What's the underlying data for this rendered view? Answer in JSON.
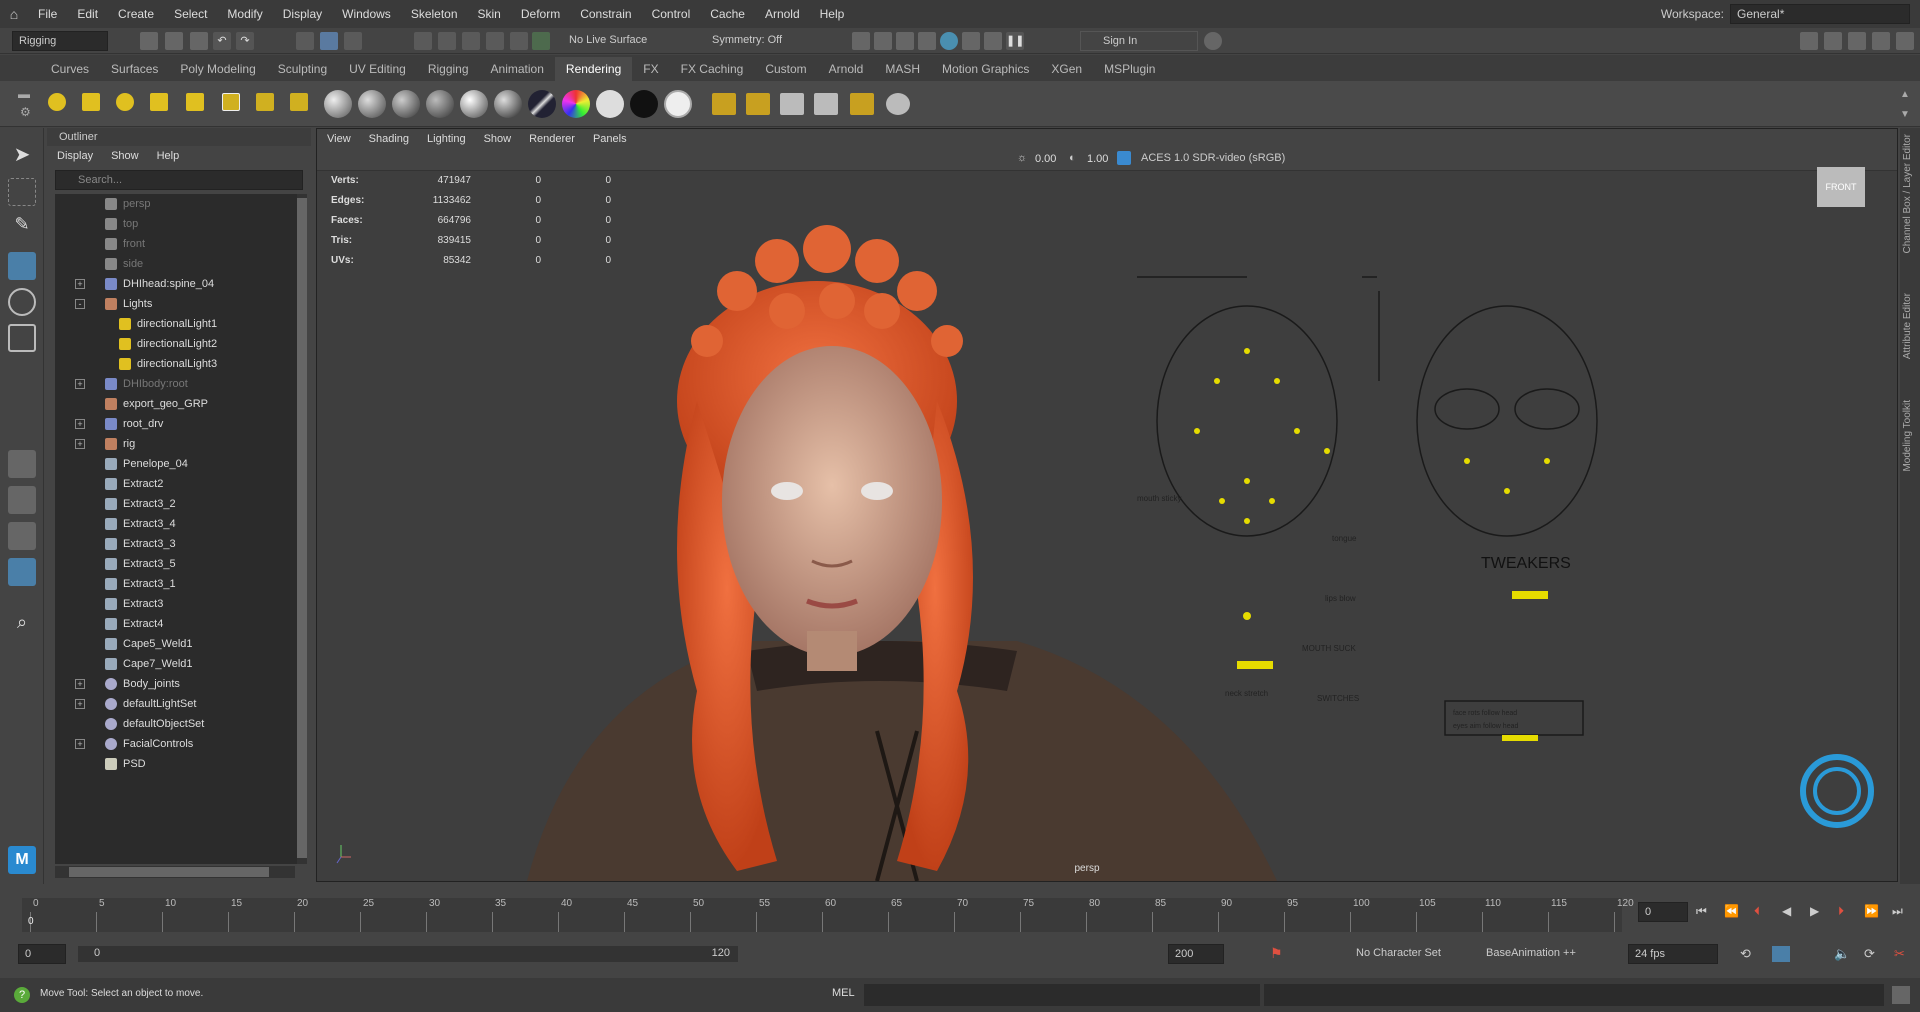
{
  "menubar": {
    "items": [
      "File",
      "Edit",
      "Create",
      "Select",
      "Modify",
      "Display",
      "Windows",
      "Skeleton",
      "Skin",
      "Deform",
      "Constrain",
      "Control",
      "Cache",
      "Arnold",
      "Help"
    ],
    "workspace_label": "Workspace:",
    "workspace_value": "General*"
  },
  "statusline": {
    "mode": "Rigging",
    "live_surface": "No Live Surface",
    "symmetry": "Symmetry: Off",
    "sign_in": "Sign In"
  },
  "shelf": {
    "tabs": [
      "Curves",
      "Surfaces",
      "Poly Modeling",
      "Sculpting",
      "UV Editing",
      "Rigging",
      "Animation",
      "Rendering",
      "FX",
      "FX Caching",
      "Custom",
      "Arnold",
      "MASH",
      "Motion Graphics",
      "XGen",
      "MSPlugin"
    ],
    "active_tab": "Rendering"
  },
  "outliner": {
    "title": "Outliner",
    "menu": [
      "Display",
      "Show",
      "Help"
    ],
    "search_placeholder": "Search...",
    "items": [
      {
        "label": "persp",
        "indent": 0,
        "dim": true,
        "icon": "camera-icon",
        "expander": ""
      },
      {
        "label": "top",
        "indent": 0,
        "dim": true,
        "icon": "camera-icon",
        "expander": ""
      },
      {
        "label": "front",
        "indent": 0,
        "dim": true,
        "icon": "camera-icon",
        "expander": ""
      },
      {
        "label": "side",
        "indent": 0,
        "dim": true,
        "icon": "camera-icon",
        "expander": ""
      },
      {
        "label": "DHIhead:spine_04",
        "indent": 0,
        "dim": false,
        "icon": "joint-icon",
        "expander": "+"
      },
      {
        "label": "Lights",
        "indent": 0,
        "dim": false,
        "icon": "group-icon",
        "expander": "-"
      },
      {
        "label": "directionalLight1",
        "indent": 1,
        "dim": false,
        "icon": "light-icon",
        "expander": ""
      },
      {
        "label": "directionalLight2",
        "indent": 1,
        "dim": false,
        "icon": "light-icon",
        "expander": ""
      },
      {
        "label": "directionalLight3",
        "indent": 1,
        "dim": false,
        "icon": "light-icon",
        "expander": ""
      },
      {
        "label": "DHIbody:root",
        "indent": 0,
        "dim": true,
        "icon": "joint-icon",
        "expander": "+"
      },
      {
        "label": "export_geo_GRP",
        "indent": 0,
        "dim": false,
        "icon": "group-icon",
        "expander": ""
      },
      {
        "label": "root_drv",
        "indent": 0,
        "dim": false,
        "icon": "joint-icon",
        "expander": "+"
      },
      {
        "label": "rig",
        "indent": 0,
        "dim": false,
        "icon": "group-icon",
        "expander": "+"
      },
      {
        "label": "Penelope_04",
        "indent": 0,
        "dim": false,
        "icon": "mesh-icon",
        "expander": ""
      },
      {
        "label": "Extract2",
        "indent": 0,
        "dim": false,
        "icon": "mesh-icon",
        "expander": ""
      },
      {
        "label": "Extract3_2",
        "indent": 0,
        "dim": false,
        "icon": "mesh-icon",
        "expander": ""
      },
      {
        "label": "Extract3_4",
        "indent": 0,
        "dim": false,
        "icon": "mesh-icon",
        "expander": ""
      },
      {
        "label": "Extract3_3",
        "indent": 0,
        "dim": false,
        "icon": "mesh-icon",
        "expander": ""
      },
      {
        "label": "Extract3_5",
        "indent": 0,
        "dim": false,
        "icon": "mesh-icon",
        "expander": ""
      },
      {
        "label": "Extract3_1",
        "indent": 0,
        "dim": false,
        "icon": "mesh-icon",
        "expander": ""
      },
      {
        "label": "Extract3",
        "indent": 0,
        "dim": false,
        "icon": "mesh-icon",
        "expander": ""
      },
      {
        "label": "Extract4",
        "indent": 0,
        "dim": false,
        "icon": "mesh-icon",
        "expander": ""
      },
      {
        "label": "Cape5_Weld1",
        "indent": 0,
        "dim": false,
        "icon": "mesh-icon",
        "expander": ""
      },
      {
        "label": "Cape7_Weld1",
        "indent": 0,
        "dim": false,
        "icon": "mesh-icon",
        "expander": ""
      },
      {
        "label": "Body_joints",
        "indent": 0,
        "dim": false,
        "icon": "set-icon",
        "expander": "+"
      },
      {
        "label": "defaultLightSet",
        "indent": 0,
        "dim": false,
        "icon": "set-icon",
        "expander": "+"
      },
      {
        "label": "defaultObjectSet",
        "indent": 0,
        "dim": false,
        "icon": "set-icon",
        "expander": ""
      },
      {
        "label": "FacialControls",
        "indent": 0,
        "dim": false,
        "icon": "set-icon",
        "expander": "+"
      },
      {
        "label": "PSD",
        "indent": 0,
        "dim": false,
        "icon": "psd-icon",
        "expander": ""
      }
    ]
  },
  "viewport": {
    "menu": [
      "View",
      "Shading",
      "Lighting",
      "Show",
      "Renderer",
      "Panels"
    ],
    "exposure": "0.00",
    "gamma": "1.00",
    "color_space": "ACES 1.0 SDR-video (sRGB)",
    "camera_label": "persp",
    "front_label": "FRONT",
    "hud": [
      {
        "k": "Verts:",
        "v": "471947",
        "a": "0",
        "b": "0"
      },
      {
        "k": "Edges:",
        "v": "1133462",
        "a": "0",
        "b": "0"
      },
      {
        "k": "Faces:",
        "v": "664796",
        "a": "0",
        "b": "0"
      },
      {
        "k": "Tris:",
        "v": "839415",
        "a": "0",
        "b": "0"
      },
      {
        "k": "UVs:",
        "v": "85342",
        "a": "0",
        "b": "0"
      }
    ],
    "rig_labels": {
      "tweakers": "TWEAKERS",
      "mouth_sticky": "mouth sticky",
      "mouth_suck": "MOUTH SUCK",
      "neck_stretch": "neck stretch",
      "tongue": "tongue",
      "lips_blow": "lips blow",
      "switches": "SWITCHES",
      "face_follow": "face rots follow head",
      "eyes_follow": "eyes aim follow head"
    }
  },
  "right_strip": [
    "Channel Box / Layer Editor",
    "Attribute Editor",
    "Modeling Toolkit"
  ],
  "timeline": {
    "ticks": [
      "0",
      "5",
      "10",
      "15",
      "20",
      "25",
      "30",
      "35",
      "40",
      "45",
      "50",
      "55",
      "60",
      "65",
      "70",
      "75",
      "80",
      "85",
      "90",
      "95",
      "100",
      "105",
      "110",
      "115",
      "120"
    ],
    "current_frame": "0",
    "cursor_frame": "0"
  },
  "range": {
    "start": "0",
    "inner_start": "0",
    "inner_end": "120",
    "end": "200",
    "character_set": "No Character Set",
    "anim_layer": "BaseAnimation ++",
    "fps": "24 fps"
  },
  "cmdline": {
    "help": "Move Tool: Select an object to move.",
    "lang": "MEL"
  }
}
